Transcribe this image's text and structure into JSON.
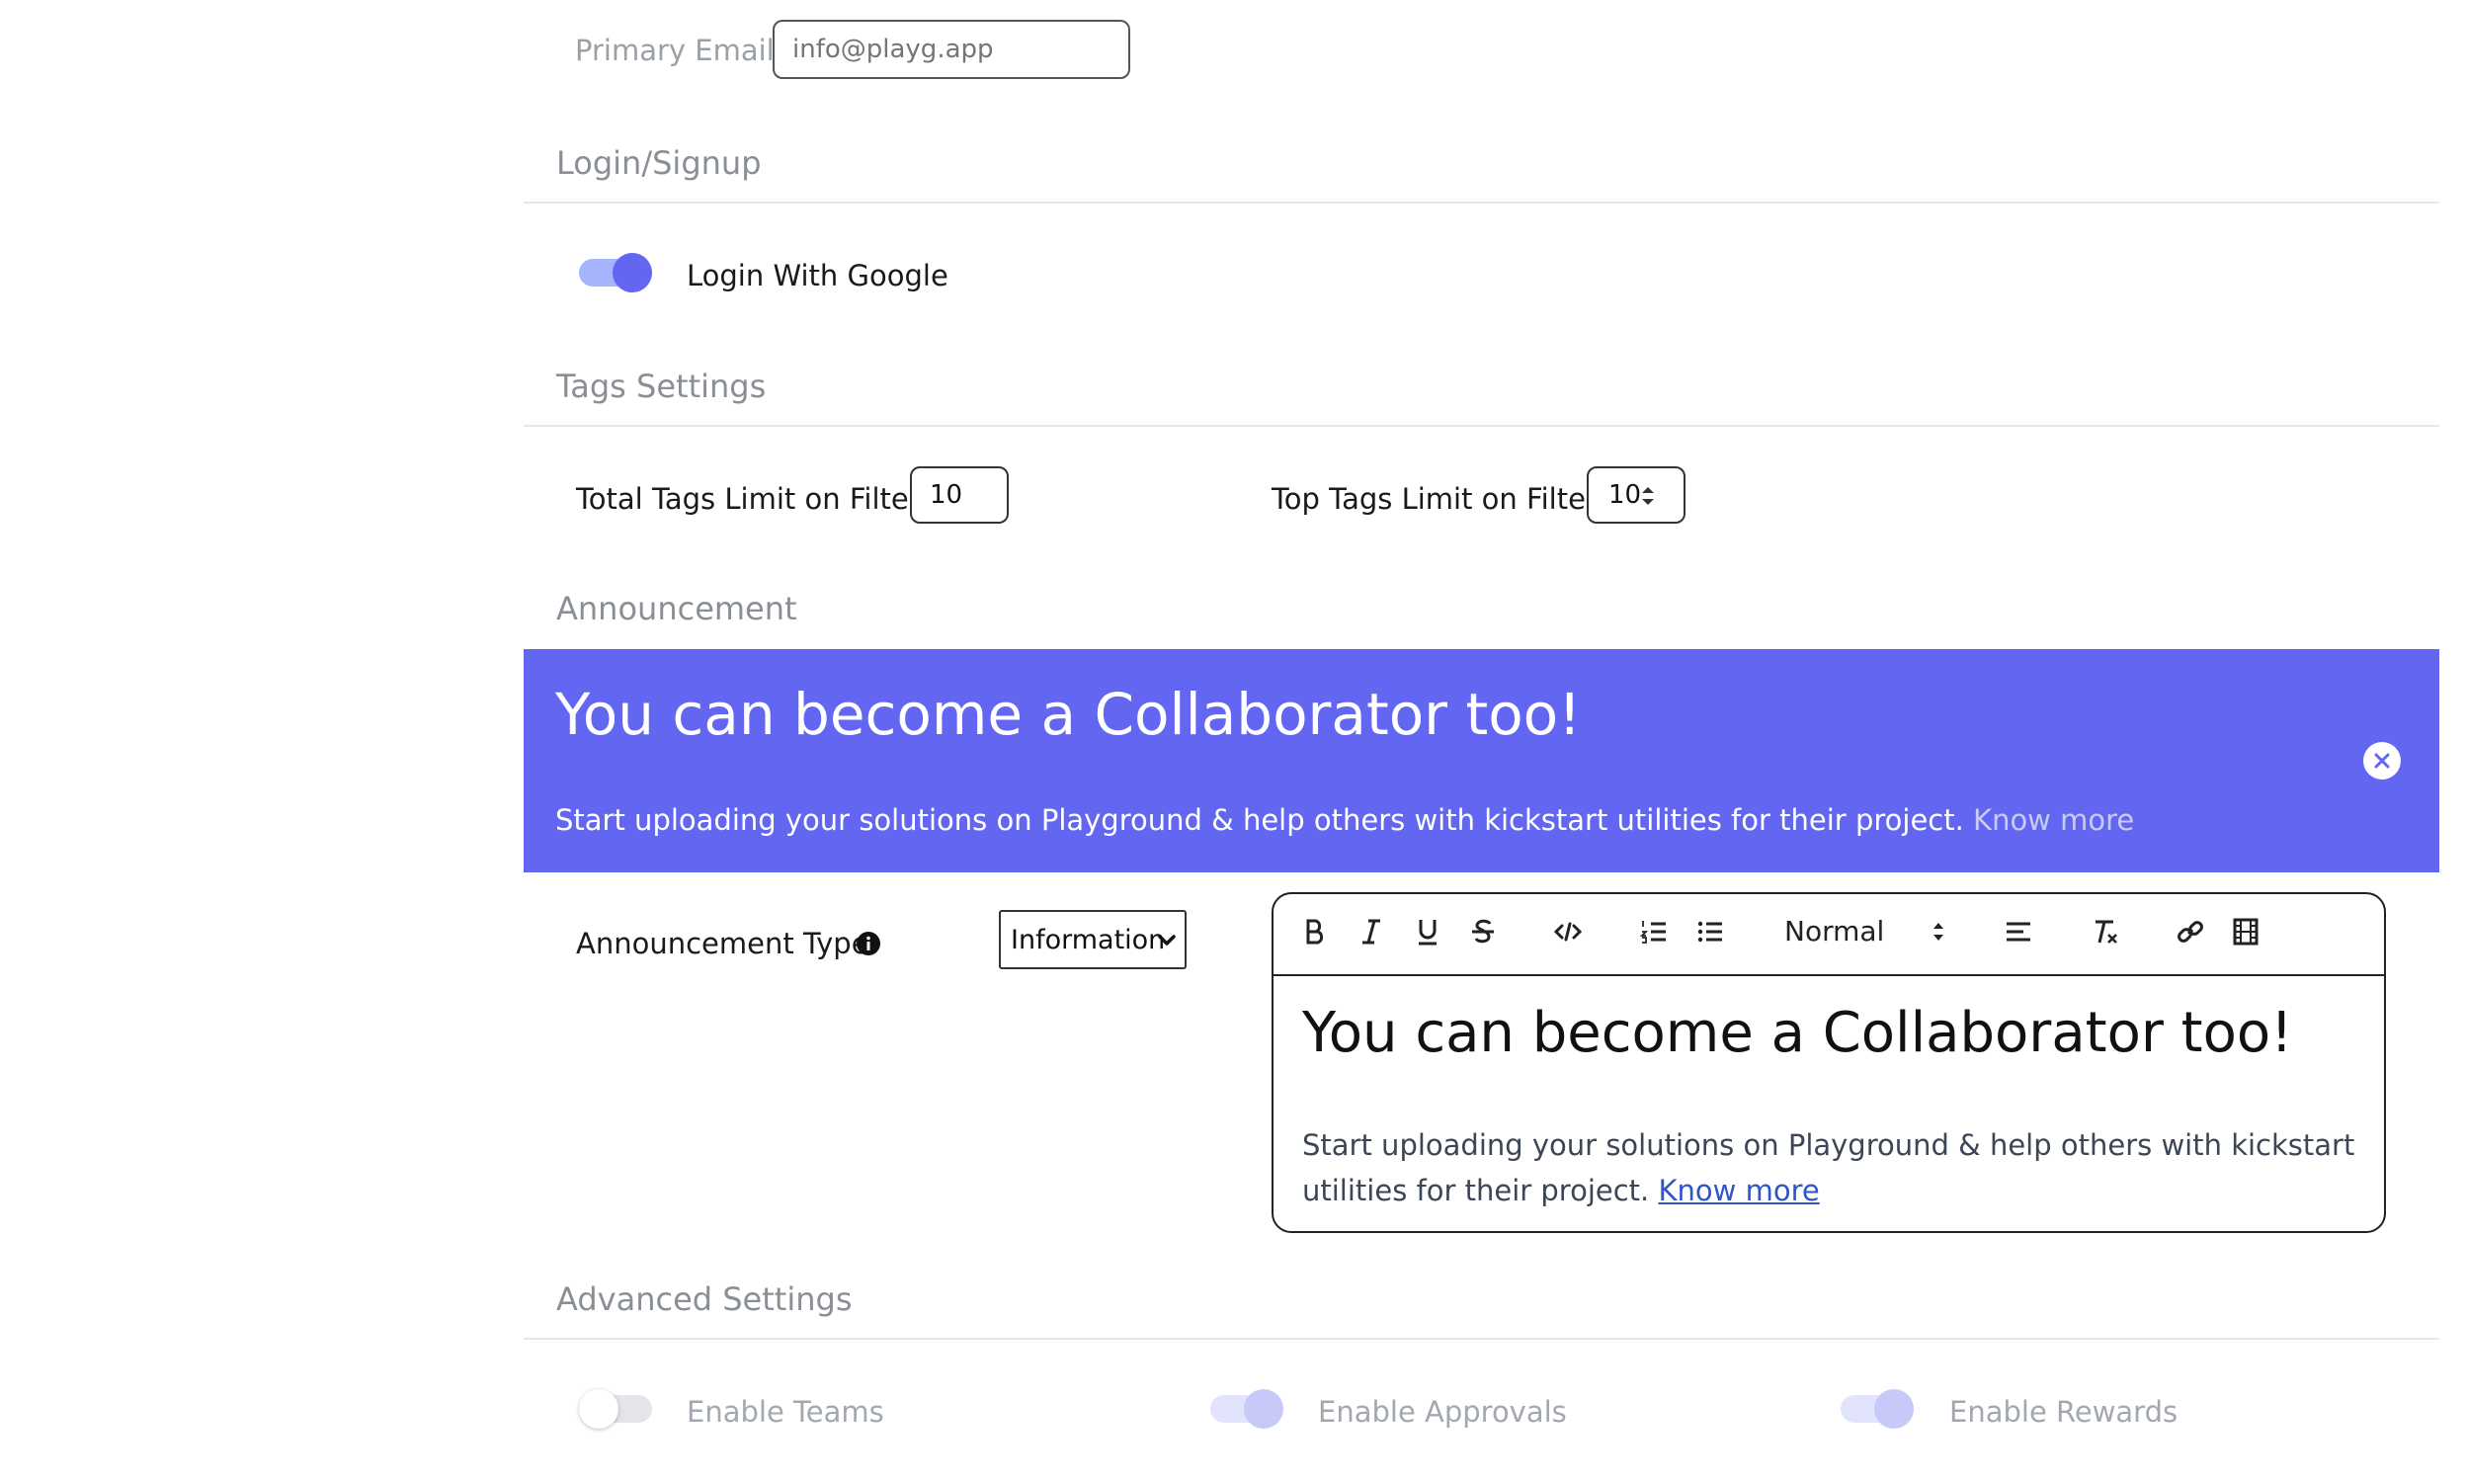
{
  "primary_email": {
    "label": "Primary Email",
    "placeholder": "info@playg.app"
  },
  "login_signup": {
    "title": "Login/Signup",
    "login_with_google": {
      "label": "Login With Google",
      "enabled": true
    }
  },
  "tags_settings": {
    "title": "Tags Settings",
    "total_tags_limit": {
      "label": "Total Tags Limit on Filter",
      "value": "10"
    },
    "top_tags_limit": {
      "label": "Top Tags Limit on Filter",
      "value": "10"
    }
  },
  "announcement": {
    "title": "Announcement",
    "banner": {
      "heading": "You can become a Collaborator too!",
      "text": "Start uploading your solutions on Playground & help others with kickstart utilities for their project.",
      "link": "Know more",
      "background": "#6366f1"
    },
    "type": {
      "label": "Announcement Type",
      "selected": "Information"
    },
    "editor": {
      "toolbar": {
        "heading_select": "Normal"
      },
      "heading": "You can become a Collaborator too!",
      "body_line1": "Start uploading your solutions on Playground & help others with kickstart",
      "body_line2": "utilities for their project.",
      "link": "Know more"
    }
  },
  "advanced_settings": {
    "title": "Advanced Settings",
    "toggles": [
      {
        "label": "Enable Teams",
        "enabled": false
      },
      {
        "label": "Enable Approvals",
        "enabled": true
      },
      {
        "label": "Enable Rewards",
        "enabled": true
      }
    ]
  },
  "colors": {
    "accent": "#6366f1",
    "accent_light": "#a5b4fc",
    "muted_text": "#9aa0a6"
  }
}
